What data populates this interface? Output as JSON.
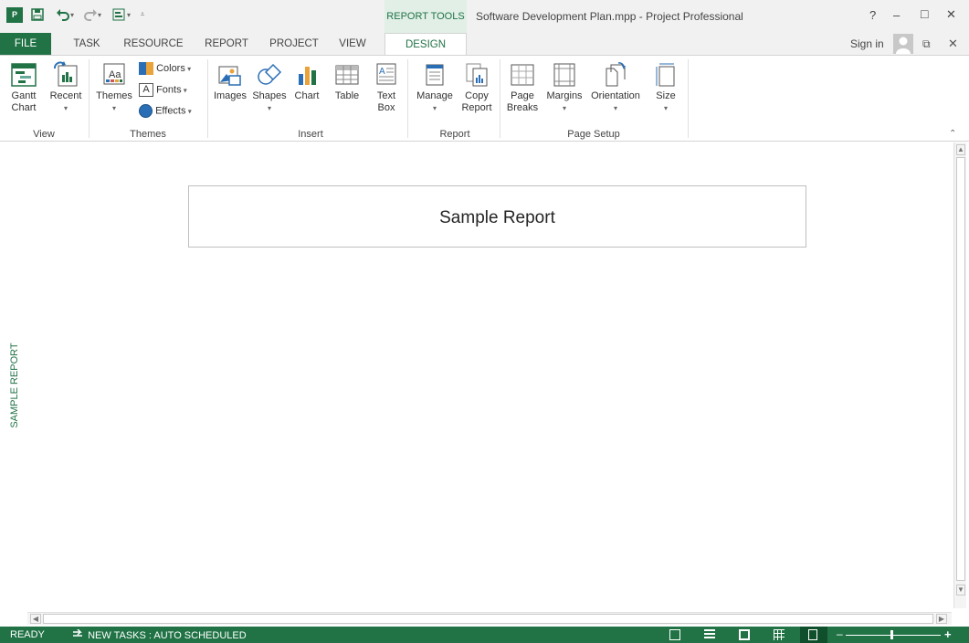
{
  "window": {
    "app_icon": "project-app-icon",
    "title": "Software Development Plan.mpp - Project Professional",
    "contextual_tab_group": "REPORT TOOLS",
    "controls": {
      "help": "?",
      "minimize": "–",
      "maximize": "□",
      "close": "✕"
    }
  },
  "qat": {
    "save_icon": "save-icon",
    "undo_icon": "undo-icon",
    "redo_icon": "redo-icon",
    "custom_icon": "view-icon",
    "customize_icon": "customize-qat-icon"
  },
  "tabs": [
    "FILE",
    "TASK",
    "RESOURCE",
    "REPORT",
    "PROJECT",
    "VIEW",
    "DESIGN"
  ],
  "active_tab": "DESIGN",
  "account": {
    "sign_in": "Sign in"
  },
  "ribbon": {
    "groups": {
      "view": {
        "label": "View",
        "gantt_chart": "Gantt\nChart",
        "recent": "Recent"
      },
      "themes": {
        "label": "Themes",
        "themes": "Themes",
        "colors": "Colors",
        "fonts": "Fonts",
        "effects": "Effects"
      },
      "insert": {
        "label": "Insert",
        "images": "Images",
        "shapes": "Shapes",
        "chart": "Chart",
        "table": "Table",
        "text_box_1": "Text",
        "text_box_2": "Box"
      },
      "report": {
        "label": "Report",
        "manage": "Manage",
        "copy_1": "Copy",
        "copy_2": "Report"
      },
      "page_setup": {
        "label": "Page Setup",
        "page_breaks_1": "Page",
        "page_breaks_2": "Breaks",
        "margins": "Margins",
        "orientation": "Orientation",
        "size": "Size"
      }
    }
  },
  "view_bar_label": "SAMPLE REPORT",
  "report": {
    "title": "Sample Report"
  },
  "status": {
    "ready": "READY",
    "new_tasks": "NEW TASKS : AUTO SCHEDULED"
  },
  "colors": {
    "accent": "#217346",
    "accent_text": "#217346"
  }
}
